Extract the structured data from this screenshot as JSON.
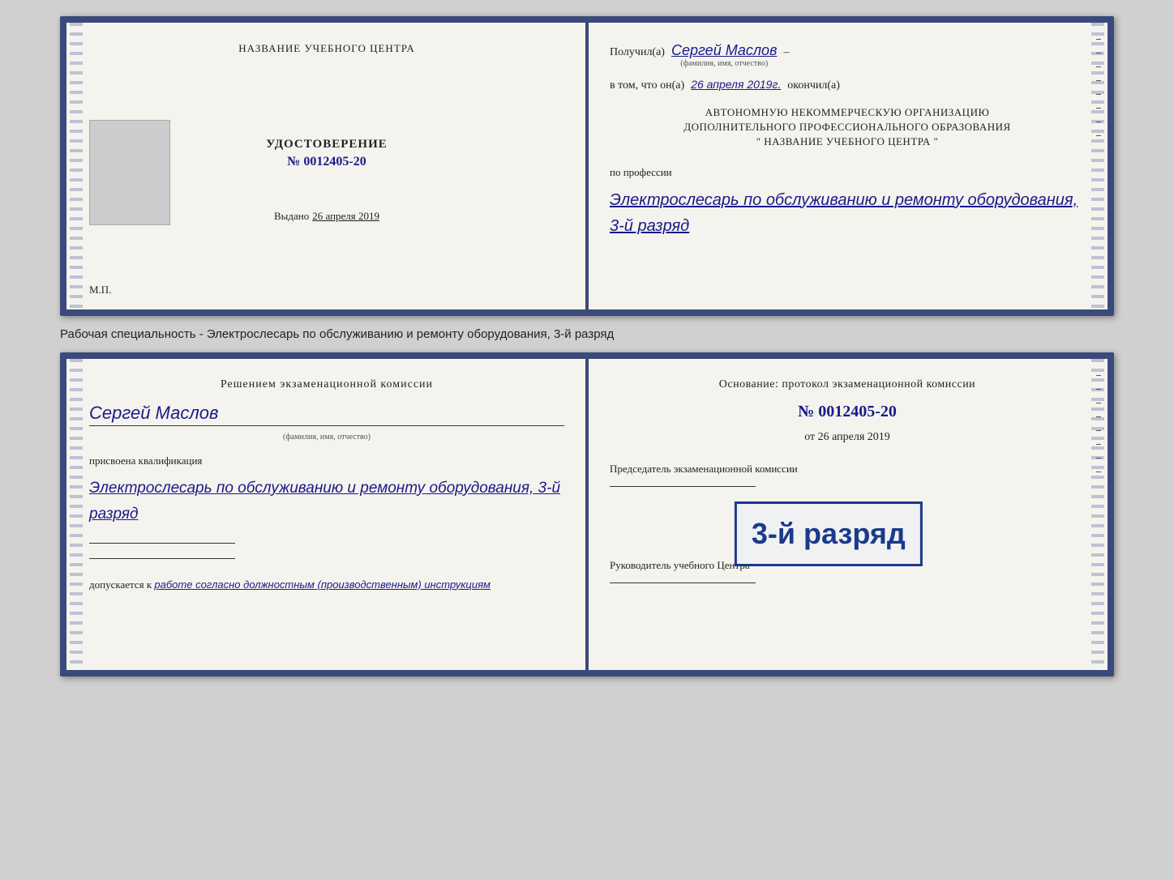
{
  "top_cert": {
    "left": {
      "center_title": "НАЗВАНИЕ УЧЕБНОГО ЦЕНТРА",
      "udostoverenie": "УДОСТОВЕРЕНИЕ",
      "number_label": "№",
      "number": "0012405-20",
      "issued_label": "Выдано",
      "issued_date": "26 апреля 2019",
      "mp": "М.П."
    },
    "right": {
      "received_label": "Получил(а)",
      "recipient_name": "Сергей Маслов",
      "fio_sub": "(фамилия, имя, отчество)",
      "in_that_label": "в том, что он(а)",
      "date_completed": "26 апреля 2019г.",
      "finished_label": "окончил(а)",
      "org_line1": "АВТОНОМНУЮ НЕКОММЕРЧЕСКУЮ ОРГАНИЗАЦИЮ",
      "org_line2": "ДОПОЛНИТЕЛЬНОГО ПРОФЕССИОНАЛЬНОГО ОБРАЗОВАНИЯ",
      "org_line3": "\"   НАЗВАНИЕ УЧЕБНОГО ЦЕНТРА   \"",
      "profession_label": "по профессии",
      "profession_handwritten": "Электрослесарь по обслуживанию и ремонту оборудования, 3-й разряд"
    }
  },
  "between_text": "Рабочая специальность - Электрослесарь по обслуживанию и ремонту оборудования, 3-й разряд",
  "bottom_cert": {
    "left": {
      "decision_title": "Решением экзаменационной комиссии",
      "person_name": "Сергей Маслов",
      "fio_sub": "(фамилия, имя, отчество)",
      "assigned_text": "присвоена квалификация",
      "qualification": "Электрослесарь по обслуживанию и ремонту оборудования, 3-й разряд",
      "admit_label": "допускается к",
      "admit_text": "работе согласно должностным (производственным) инструкциям"
    },
    "right": {
      "basis_title": "Основание: протокол экзаменационной комиссии",
      "protocol_label": "№",
      "protocol_number": "0012405-20",
      "date_label": "от",
      "protocol_date": "26 апреля 2019",
      "chairman_label": "Председатель экзаменационной комиссии",
      "rukovoditel_label": "Руководитель учебного Центра"
    },
    "stamp": {
      "line1": "3-й разряд"
    }
  }
}
